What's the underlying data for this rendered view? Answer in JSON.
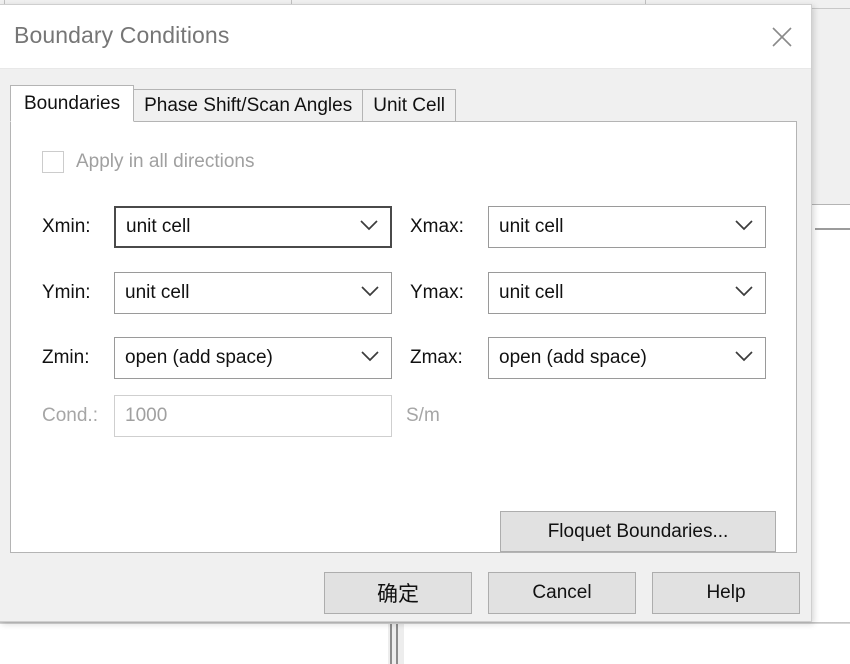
{
  "dialog": {
    "title": "Boundary Conditions",
    "close_icon": "close-icon"
  },
  "tabs": [
    {
      "label": "Boundaries",
      "active": true
    },
    {
      "label": "Phase Shift/Scan Angles",
      "active": false
    },
    {
      "label": "Unit Cell",
      "active": false
    }
  ],
  "boundaries": {
    "apply_all": {
      "label": "Apply in all directions",
      "checked": false,
      "disabled": true
    },
    "fields": [
      {
        "label": "Xmin:",
        "value": "unit cell",
        "focused": true
      },
      {
        "label": "Xmax:",
        "value": "unit cell",
        "focused": false
      },
      {
        "label": "Ymin:",
        "value": "unit cell",
        "focused": false
      },
      {
        "label": "Ymax:",
        "value": "unit cell",
        "focused": false
      },
      {
        "label": "Zmin:",
        "value": "open (add space)",
        "focused": false
      },
      {
        "label": "Zmax:",
        "value": "open (add space)",
        "focused": false
      }
    ],
    "cond": {
      "label": "Cond.:",
      "value": "1000",
      "unit": "S/m",
      "disabled": true
    },
    "floquet_button": "Floquet Boundaries..."
  },
  "footer": {
    "ok": "确定",
    "cancel": "Cancel",
    "help": "Help"
  },
  "colors": {
    "dialog_bg": "#f0f0f0",
    "panel_bg": "#ffffff",
    "title_text": "#767676",
    "disabled_text": "#a0a0a0",
    "button_face": "#e1e1e1",
    "border": "#b4b4b4",
    "focus_border": "#4a4a4a"
  }
}
